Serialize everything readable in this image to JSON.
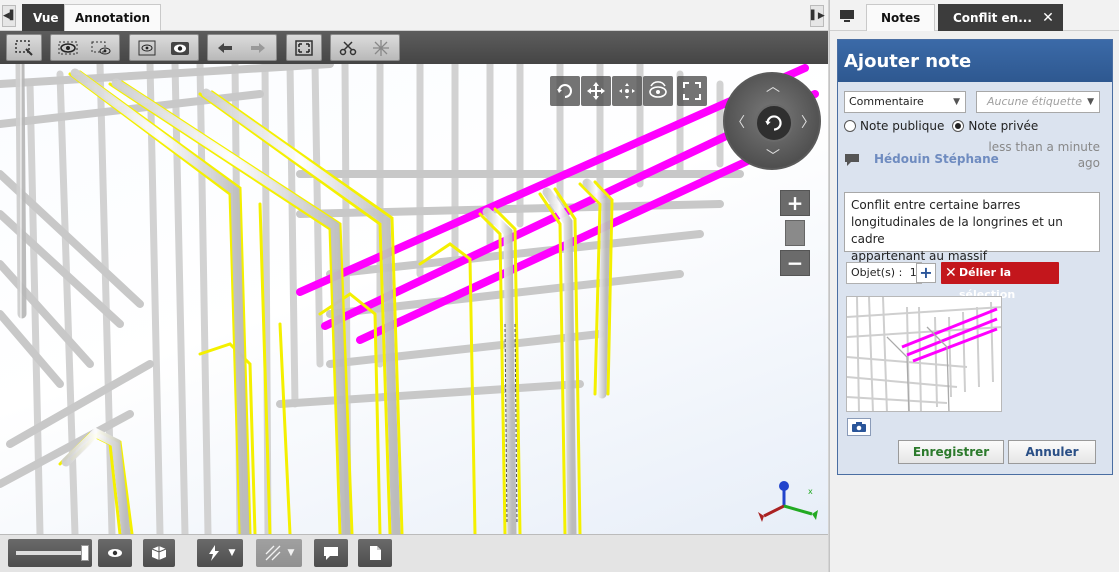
{
  "viewer": {
    "tabs": [
      {
        "label": "Vue",
        "active": true
      },
      {
        "label": "Annotation",
        "active": false
      }
    ],
    "toolbar_icons": [
      "selection-box-icon",
      "visibility-eye-icon",
      "hide-selection-icon",
      "section-box-icon",
      "camera-eye-icon",
      "undo-arrow-icon",
      "redo-arrow-icon",
      "fit-view-icon",
      "cut-plane-icon",
      "explode-icon"
    ],
    "nav_icons": [
      "orbit-icon",
      "pan-icon",
      "move-icon",
      "look-around-icon",
      "fullscreen-icon"
    ],
    "bottom_icons": [
      "transparency-slider",
      "eye-icon",
      "cube-icon",
      "lightning-icon",
      "ghost-icon",
      "comment-icon",
      "document-icon"
    ],
    "accent_colors": {
      "rebar_highlight": "#ffff66",
      "conflict_bar": "#ff00ff",
      "toolbar": "#4f4f4f"
    }
  },
  "side_panel": {
    "tabs": [
      {
        "label": "Notes",
        "active": false
      },
      {
        "label": "Conflit en...",
        "active": true
      }
    ],
    "note_form": {
      "title": "Ajouter note",
      "type_select": "Commentaire",
      "tag_placeholder": "Aucune étiquette",
      "visibility_options": [
        {
          "label": "Note publique",
          "selected": false
        },
        {
          "label": "Note privée",
          "selected": true
        }
      ],
      "author": "Hédouin Stéphane",
      "time_line1": "less than a minute",
      "time_line2": "ago",
      "comment_line1": "Conflit entre certaine barres",
      "comment_line2": "longitudinales de la longrines et un cadre",
      "comment_line3": "appartenant au massif",
      "objects_label": "Objet(s) :",
      "objects_count": "1",
      "unlink_label": "Délier la sélection",
      "save_label": "Enregistrer",
      "cancel_label": "Annuler",
      "colors": {
        "header": "#3564a0",
        "save_text": "#2c7a2c",
        "unlink": "#c3161c",
        "author": "#6f8cc0"
      }
    }
  }
}
